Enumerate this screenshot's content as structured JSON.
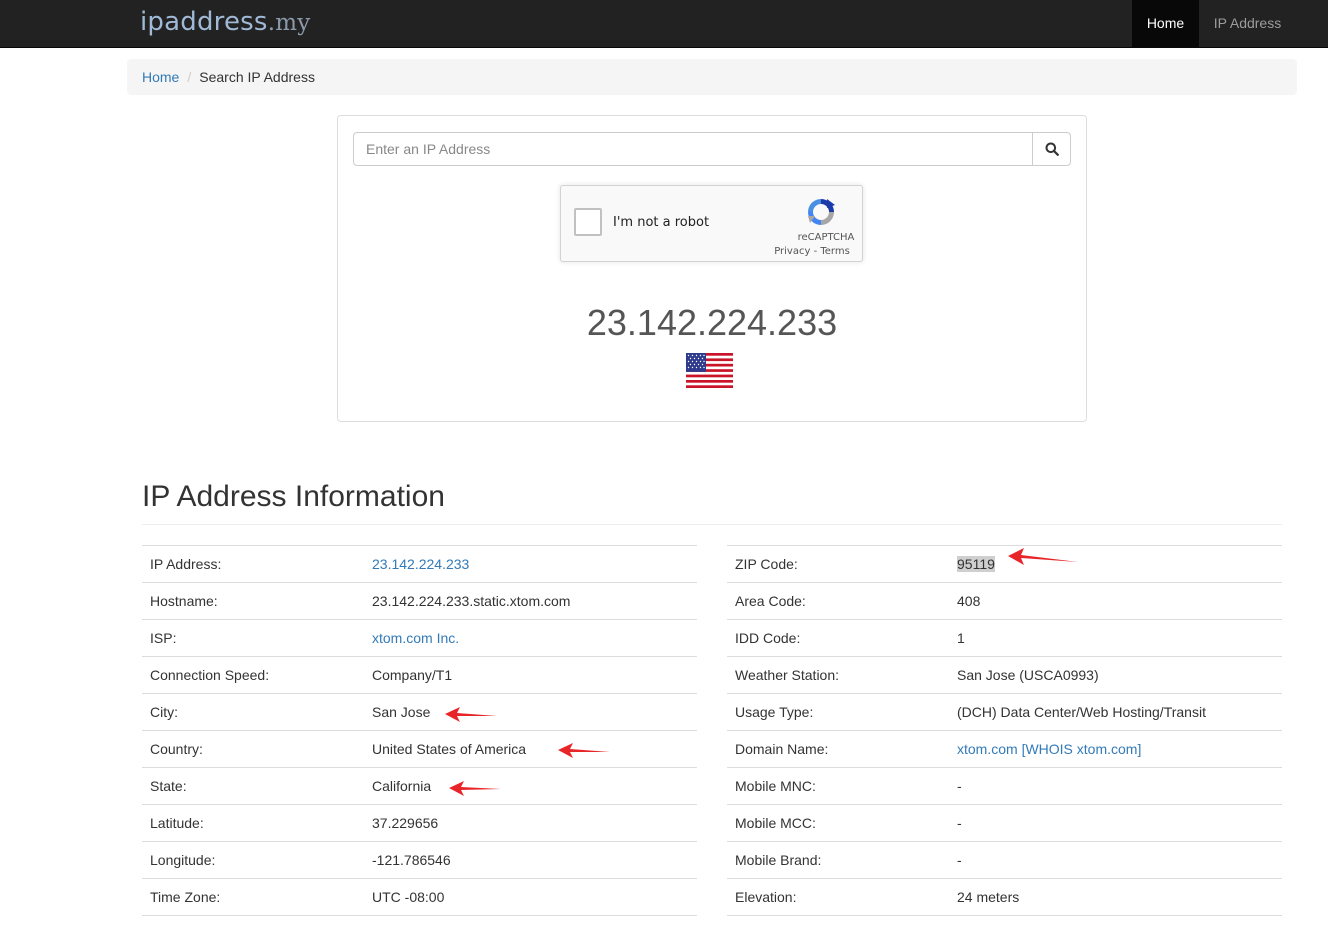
{
  "navbar": {
    "brand": "ipaddress",
    "brand_tld": ".my",
    "items": [
      {
        "label": "Home",
        "active": true
      },
      {
        "label": "IP Address",
        "active": false
      }
    ]
  },
  "breadcrumb": {
    "home": "Home",
    "separator": "/",
    "current": "Search IP Address"
  },
  "search": {
    "placeholder": "Enter an IP Address",
    "button_icon": "search-icon"
  },
  "recaptcha": {
    "label": "I'm not a robot",
    "brand": "reCAPTCHA",
    "links": "Privacy - Terms"
  },
  "result": {
    "ip": "23.142.224.233",
    "flag_icon": "us-flag-icon"
  },
  "info": {
    "title": "IP Address Information",
    "left": [
      {
        "label": "IP Address:",
        "value": "23.142.224.233",
        "link": true
      },
      {
        "label": "Hostname:",
        "value": "23.142.224.233.static.xtom.com",
        "link": false
      },
      {
        "label": "ISP:",
        "value": "xtom.com Inc.",
        "link": true
      },
      {
        "label": "Connection Speed:",
        "value": "Company/T1",
        "link": false
      },
      {
        "label": "City:",
        "value": "San Jose",
        "link": false
      },
      {
        "label": "Country:",
        "value": "United States of America",
        "link": false
      },
      {
        "label": "State:",
        "value": "California",
        "link": false
      },
      {
        "label": "Latitude:",
        "value": "37.229656",
        "link": false
      },
      {
        "label": "Longitude:",
        "value": "-121.786546",
        "link": false
      },
      {
        "label": "Time Zone:",
        "value": "UTC -08:00",
        "link": false
      }
    ],
    "right": [
      {
        "label": "ZIP Code:",
        "value": "95119",
        "link": false
      },
      {
        "label": "Area Code:",
        "value": "408",
        "link": false
      },
      {
        "label": "IDD Code:",
        "value": "1",
        "link": false
      },
      {
        "label": "Weather Station:",
        "value": "San Jose (USCA0993)",
        "link": false
      },
      {
        "label": "Usage Type:",
        "value": "(DCH) Data Center/Web Hosting/Transit",
        "link": false
      },
      {
        "label": "Domain Name:",
        "value": "xtom.com [WHOIS xtom.com]",
        "link": true
      },
      {
        "label": "Mobile MNC:",
        "value": "-",
        "link": false
      },
      {
        "label": "Mobile MCC:",
        "value": "-",
        "link": false
      },
      {
        "label": "Mobile Brand:",
        "value": "-",
        "link": false
      },
      {
        "label": "Elevation:",
        "value": "24 meters",
        "link": false
      }
    ]
  },
  "colors": {
    "navbar_bg": "#222222",
    "link": "#337ab7",
    "annotation_arrow": "#e8262a"
  }
}
